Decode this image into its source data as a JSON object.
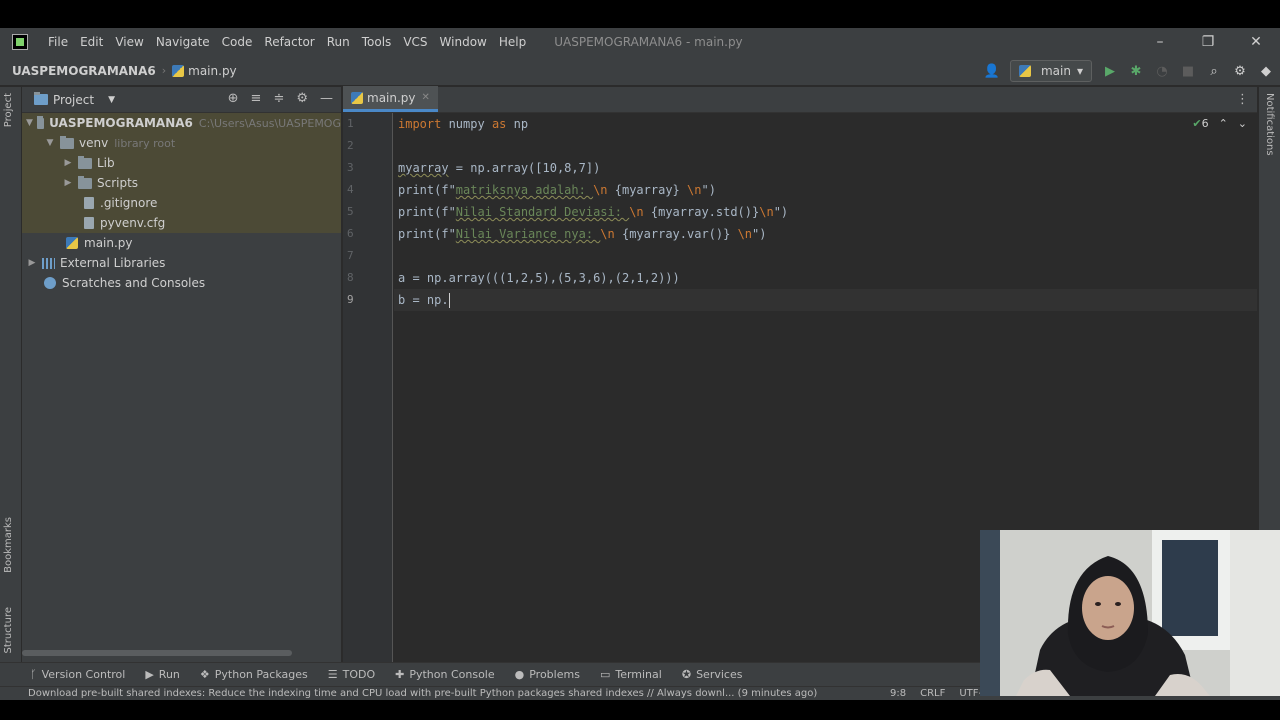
{
  "app": {
    "menu": [
      "File",
      "Edit",
      "View",
      "Navigate",
      "Code",
      "Refactor",
      "Run",
      "Tools",
      "VCS",
      "Window",
      "Help"
    ],
    "window_title": "UASPEMOGRAMANA6 - main.py",
    "window_controls": [
      "–",
      "❐",
      "✕"
    ]
  },
  "navbar": {
    "project": "UASPEMOGRAMANA6",
    "file": "main.py",
    "run_config": "main"
  },
  "project_panel": {
    "title": "Project",
    "tree": {
      "root_name": "UASPEMOGRAMANA6",
      "root_path": "C:\\Users\\Asus\\UASPEMOG",
      "venv": "venv",
      "venv_note": "library root",
      "lib": "Lib",
      "scripts": "Scripts",
      "gitignore": ".gitignore",
      "pyvenv": "pyvenv.cfg",
      "main": "main.py",
      "external": "External Libraries",
      "scratches": "Scratches and Consoles"
    }
  },
  "editor": {
    "tab": "main.py",
    "inspection_count": "6",
    "line_numbers": [
      "1",
      "2",
      "3",
      "4",
      "5",
      "6",
      "7",
      "8",
      "9"
    ],
    "code": {
      "l1_kw1": "import",
      "l1_mid": " numpy ",
      "l1_kw2": "as",
      "l1_end": " np",
      "l3_var": "myarray",
      "l3_rest": " = np.array([10,8,7])",
      "l4_a": "print(f\"",
      "l4_s1": "matriksnya adalah: ",
      "l4_e1": "\\n",
      "l4_b": " {myarray} ",
      "l4_e2": "\\n",
      "l4_c": "\")",
      "l5_a": "print(f\"",
      "l5_s1": "Nilai Standard Deviasi: ",
      "l5_e1": "\\n",
      "l5_b": " {myarray.std()}",
      "l5_e2": "\\n",
      "l5_c": "\")",
      "l6_a": "print(f\"",
      "l6_s1": "Nilai Variance nya: ",
      "l6_e1": "\\n",
      "l6_b": " {myarray.var()} ",
      "l6_e2": "\\n",
      "l6_c": "\")",
      "l8": "a = np.array(((1,2,5),(5,3,6),(2,1,2)))",
      "l9": "b = np."
    }
  },
  "bottom_tools": [
    "Version Control",
    "Run",
    "Python Packages",
    "TODO",
    "Python Console",
    "Problems",
    "Terminal",
    "Services"
  ],
  "status": {
    "message": "Download pre-built shared indexes: Reduce the indexing time and CPU load with pre-built Python packages shared indexes // Always downl... (9 minutes ago)",
    "position": "9:8",
    "line_sep": "CRLF",
    "encoding": "UTF-"
  },
  "side_labels": {
    "project": "Project",
    "bookmarks": "Bookmarks",
    "structure": "Structure",
    "notifications": "Notifications"
  }
}
